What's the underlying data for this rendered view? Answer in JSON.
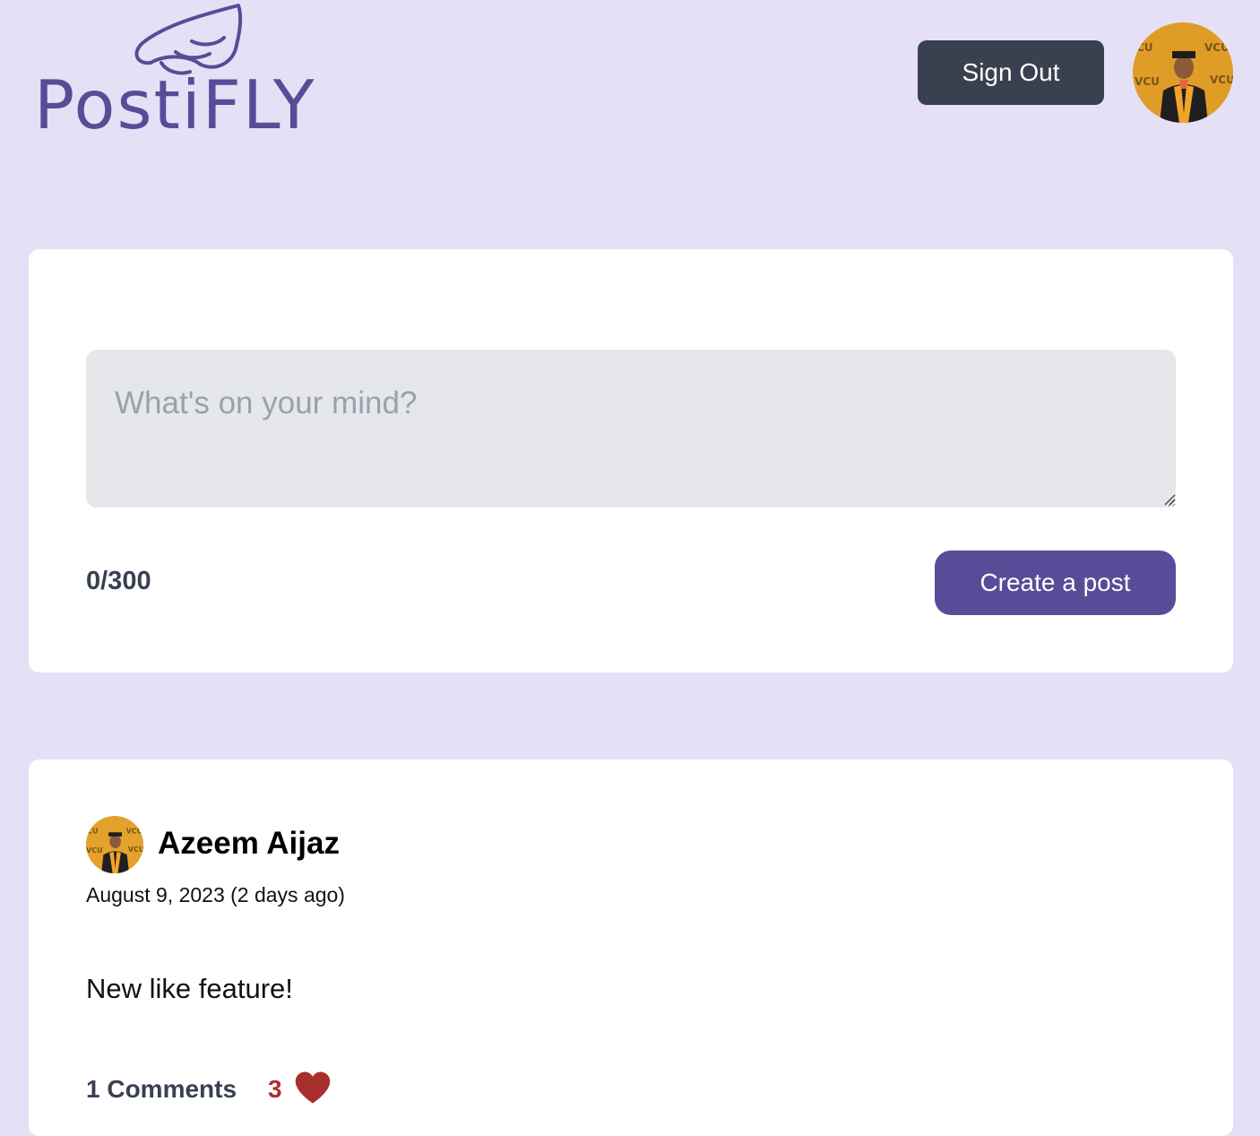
{
  "header": {
    "logo_text": "PostiFLY",
    "sign_out_label": "Sign Out",
    "avatar_alt": "User avatar"
  },
  "composer": {
    "placeholder": "What's on your mind?",
    "value": "",
    "char_count": "0/300",
    "submit_label": "Create a post"
  },
  "posts": [
    {
      "author": "Azeem Aijaz",
      "date": "August 9, 2023 (2 days ago)",
      "body": "New like feature!",
      "comments_label": "1 Comments",
      "likes": "3"
    }
  ],
  "colors": {
    "page_bg": "#e6e0f7",
    "brand_purple": "#5a4b98",
    "dark_button": "#394150",
    "like_red": "#a8302c",
    "input_bg": "#e5e7eb"
  },
  "icons": {
    "logo_wing": "wing-icon",
    "heart": "heart-icon",
    "resize": "resize-grip-icon"
  }
}
